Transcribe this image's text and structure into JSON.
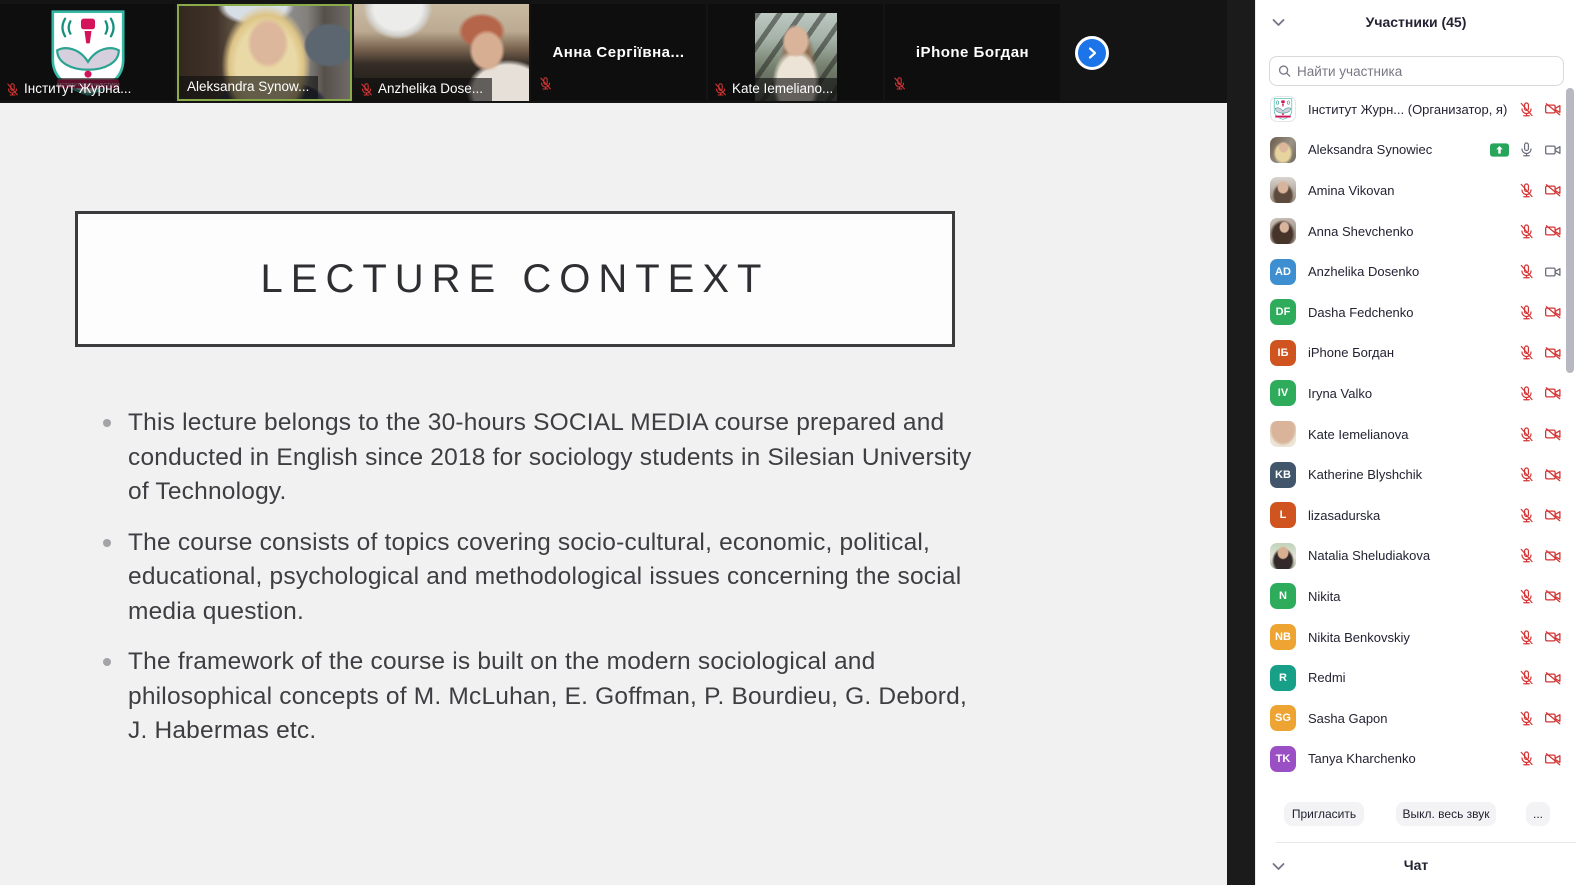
{
  "video_strip": {
    "tiles": [
      {
        "name": "Інститут Журна...",
        "kind": "logo",
        "muted": true,
        "active": false
      },
      {
        "name": "Aleksandra Synow...",
        "kind": "photo",
        "photo": "ph-aleksandra",
        "muted": false,
        "active": true
      },
      {
        "name": "Anzhelika Dose...",
        "kind": "photo",
        "photo": "ph-anzhelika",
        "muted": true,
        "active": false
      },
      {
        "name": "Анна  Сергіївна...",
        "kind": "center",
        "muted": true,
        "active": false
      },
      {
        "name": "Kate Iemeliano...",
        "kind": "kate",
        "photo": "ph-kate",
        "muted": true,
        "active": false
      },
      {
        "name": "iPhone Богдан",
        "kind": "center",
        "muted": true,
        "active": false
      }
    ],
    "next_button_icon": "chevron-right"
  },
  "slide": {
    "title": "LECTURE CONTEXT",
    "bullets": [
      "This lecture belongs to the 30-hours SOCIAL MEDIA course prepared and conducted in English since 2018 for sociology students in Silesian University of Technology.",
      "The course consists of topics covering socio-cultural, economic, political, educational, psychological and methodological issues concerning the social media question.",
      "The framework of the course is built on the modern sociological and philosophical concepts of M. McLuhan, E. Goffman, P. Bourdieu, G. Debord,  J. Habermas etc."
    ]
  },
  "sidebar": {
    "participants_header": "Участники (45)",
    "search_placeholder": "Найти участника",
    "participants": [
      {
        "name": "Інститут Журн... (Организатор, я)",
        "avatar": "logo",
        "mic": "off",
        "cam": "off"
      },
      {
        "name": "Aleksandra Synowiec",
        "avatar": "photo:ph-aleks-av",
        "badge": "sharing",
        "mic": "on",
        "cam": "on"
      },
      {
        "name": "Amina Vikovan",
        "avatar": "photo:ph-amina",
        "mic": "off",
        "cam": "off"
      },
      {
        "name": "Anna Shevchenko",
        "avatar": "photo:ph-anna",
        "mic": "off",
        "cam": "off"
      },
      {
        "name": "Anzhelika Dosenko",
        "avatar": "initials:AD:#3d8fd1",
        "mic": "off",
        "cam": "on"
      },
      {
        "name": "Dasha Fedchenko",
        "avatar": "initials:DF:#2eac5b",
        "mic": "off",
        "cam": "off"
      },
      {
        "name": "iPhone Богдан",
        "avatar": "initials:ІБ:#cf5420",
        "mic": "off",
        "cam": "off"
      },
      {
        "name": "Iryna Valko",
        "avatar": "initials:IV:#2eac5b",
        "mic": "off",
        "cam": "off"
      },
      {
        "name": "Kate Iemelianova",
        "avatar": "photo:ph-kate",
        "mic": "off",
        "cam": "off"
      },
      {
        "name": "Katherine Blyshchik",
        "avatar": "initials:KB:#42566b",
        "mic": "off",
        "cam": "off"
      },
      {
        "name": "lizasadurska",
        "avatar": "initials:L:#cf5420",
        "mic": "off",
        "cam": "off"
      },
      {
        "name": "Natalia Sheludiakova",
        "avatar": "photo:ph-natalia",
        "mic": "off",
        "cam": "off"
      },
      {
        "name": "Nikita",
        "avatar": "initials:N:#2eac5b",
        "mic": "off",
        "cam": "off"
      },
      {
        "name": "Nikita Benkovskiy",
        "avatar": "initials:NB:#eda433",
        "mic": "off",
        "cam": "off"
      },
      {
        "name": "Redmi",
        "avatar": "initials:R:#17a087",
        "mic": "off",
        "cam": "off"
      },
      {
        "name": "Sasha Gapon",
        "avatar": "initials:SG:#eda433",
        "mic": "off",
        "cam": "off"
      },
      {
        "name": "Tanya Kharchenko",
        "avatar": "initials:TK:#9b4fc4",
        "mic": "off",
        "cam": "off"
      }
    ],
    "footer_buttons": [
      "Пригласить",
      "Выкл. весь звук",
      "..."
    ],
    "chat_header": "Чат"
  },
  "colors": {
    "muted_red": "#d43434",
    "icon_gray": "#6b6c7a",
    "active_speaker_border": "#8aab4a",
    "share_badge_green": "#27a55a",
    "next_button_blue": "#1b74e8"
  }
}
